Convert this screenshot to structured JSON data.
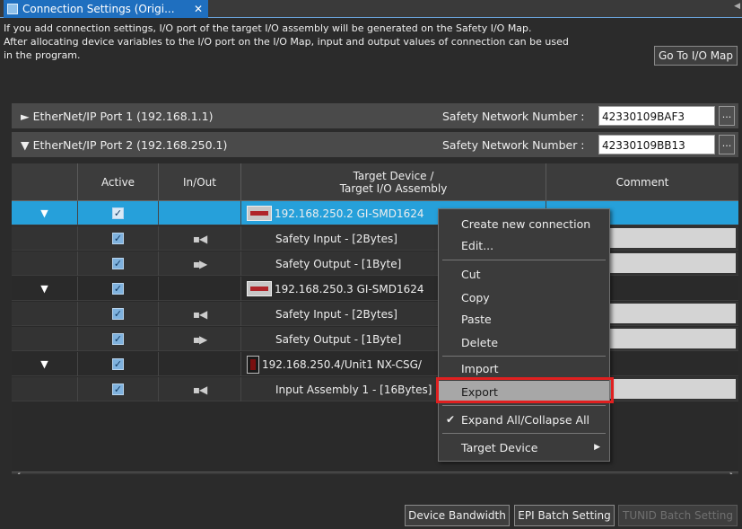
{
  "tab": {
    "title": "Connection Settings (Origi...",
    "close": "✕"
  },
  "info": {
    "line1": "If you add connection settings, I/O port of the target I/O assembly will be generated on the Safety I/O Map.",
    "line2": "After allocating device variables to the I/O port on the I/O Map, input and output values of connection can be used",
    "line3": "in the program."
  },
  "goto_button": "Go To I/O Map",
  "ports": [
    {
      "label": "EtherNet/IP Port 1 (192.168.1.1)",
      "expanded": false,
      "snn_label": "Safety Network Number :",
      "snn_value": "42330109BAF3",
      "browse": "..."
    },
    {
      "label": "EtherNet/IP Port 2 (192.168.250.1)",
      "expanded": true,
      "snn_label": "Safety Network Number :",
      "snn_value": "42330109BB13",
      "browse": "..."
    }
  ],
  "table": {
    "headers": {
      "active": "Active",
      "inout": "In/Out",
      "target_line1": "Target Device /",
      "target_line2": "Target I/O Assembly",
      "comment": "Comment"
    },
    "rows": [
      {
        "type": "device",
        "active": true,
        "text": "192.168.250.2 GI-SMD1624",
        "icon": "safety-unit-icon",
        "selected": true
      },
      {
        "type": "io",
        "active": true,
        "dir": "in",
        "text": "Safety Input - [2Bytes]"
      },
      {
        "type": "io",
        "active": true,
        "dir": "out",
        "text": "Safety Output - [1Byte]"
      },
      {
        "type": "device",
        "active": true,
        "text": "192.168.250.3 GI-SMD1624",
        "icon": "safety-unit-icon"
      },
      {
        "type": "io",
        "active": true,
        "dir": "in",
        "text": "Safety Input - [2Bytes]"
      },
      {
        "type": "io",
        "active": true,
        "dir": "out",
        "text": "Safety Output - [1Byte]"
      },
      {
        "type": "device",
        "active": true,
        "text": "192.168.250.4/Unit1 NX-CSG/",
        "icon": "nx-unit-icon"
      },
      {
        "type": "io",
        "active": true,
        "dir": "in",
        "text": "Input Assembly 1 - [16Bytes]"
      }
    ]
  },
  "context_menu": {
    "items": {
      "create": "Create new connection",
      "edit": "Edit...",
      "cut": "Cut",
      "copy": "Copy",
      "paste": "Paste",
      "delete": "Delete",
      "import": "Import",
      "export": "Export",
      "expand": "Expand All/Collapse All",
      "target": "Target Device"
    },
    "highlighted": "Export",
    "checked": "Expand All/Collapse All"
  },
  "footer": {
    "bandwidth": "Device Bandwidth",
    "epi": "EPI Batch Setting",
    "tunid": "TUNID Batch Setting"
  },
  "colors": {
    "selection": "#26a0da",
    "tab": "#1f6fbf",
    "highlight_box": "#e02020"
  }
}
